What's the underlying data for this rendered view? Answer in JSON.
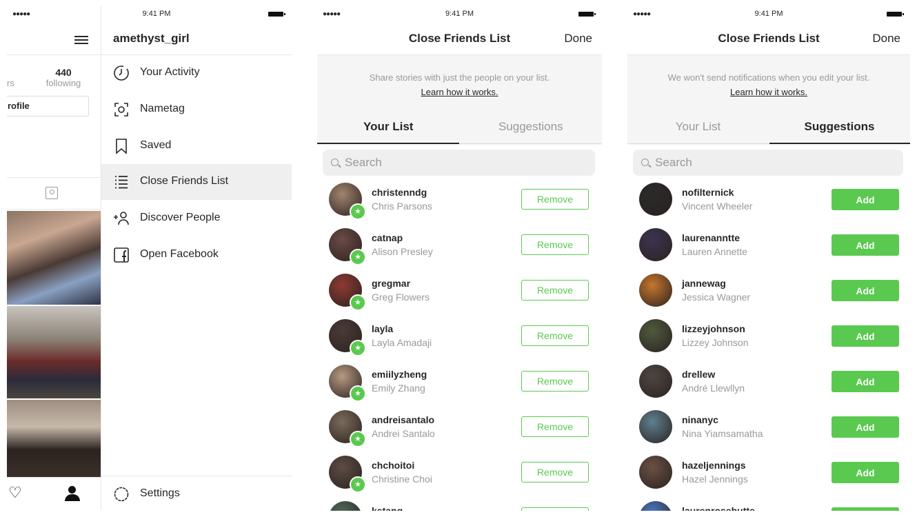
{
  "status_bar": {
    "time": "9:41 PM",
    "signal": "●●●●●"
  },
  "profile_menu": {
    "stats": {
      "following_count": "440",
      "following_label": "following",
      "followers_label_fragment": "rs"
    },
    "edit_profile_label": "rofile",
    "username": "amethyst_girl",
    "items": [
      {
        "label": "Your Activity",
        "icon": "activity-icon"
      },
      {
        "label": "Nametag",
        "icon": "nametag-icon"
      },
      {
        "label": "Saved",
        "icon": "bookmark-icon"
      },
      {
        "label": "Close Friends List",
        "icon": "list-icon",
        "active": true
      },
      {
        "label": "Discover People",
        "icon": "add-person-icon"
      },
      {
        "label": "Open Facebook",
        "icon": "facebook-icon"
      }
    ],
    "settings_label": "Settings"
  },
  "your_list_screen": {
    "title": "Close Friends List",
    "done_label": "Done",
    "info_text": "Share stories with just the people on your list.",
    "info_link": "Learn how it works.",
    "tabs": [
      "Your List",
      "Suggestions"
    ],
    "active_tab": "Your List",
    "search_placeholder": "Search",
    "button_label": "Remove",
    "rows": [
      {
        "username": "christenndg",
        "name": "Chris Parsons",
        "color": "#a2846e"
      },
      {
        "username": "catnap",
        "name": "Alison Presley",
        "color": "#6b4a45"
      },
      {
        "username": "gregmar",
        "name": "Greg Flowers",
        "color": "#8e3a32"
      },
      {
        "username": "layla",
        "name": "Layla Amadaji",
        "color": "#4a3a36"
      },
      {
        "username": "emiilyzheng",
        "name": "Emily Zhang",
        "color": "#b79a82"
      },
      {
        "username": "andreisantalo",
        "name": "Andrei Santalo",
        "color": "#7a6a5a"
      },
      {
        "username": "chchoitoi",
        "name": "Christine Choi",
        "color": "#5d4c44"
      },
      {
        "username": "kstang",
        "name": "",
        "color": "#4f6b5a"
      }
    ]
  },
  "suggestions_screen": {
    "title": "Close Friends List",
    "done_label": "Done",
    "info_text": "We won't send notifications when you edit your list.",
    "info_link": "Learn how it works.",
    "tabs": [
      "Your List",
      "Suggestions"
    ],
    "active_tab": "Suggestions",
    "search_placeholder": "Search",
    "button_label": "Add",
    "rows": [
      {
        "username": "nofilternick",
        "name": "Vincent Wheeler",
        "color": "#2a2a2a"
      },
      {
        "username": "laurenanntte",
        "name": "Lauren Annette",
        "color": "#3c3450"
      },
      {
        "username": "jannewag",
        "name": "Jessica Wagner",
        "color": "#c6762e"
      },
      {
        "username": "lizzeyjohnson",
        "name": "Lizzey Johnson",
        "color": "#4f5a3d"
      },
      {
        "username": "drellew",
        "name": "André Llewllyn",
        "color": "#4d4640"
      },
      {
        "username": "ninanyc",
        "name": "Nina Yiamsamatha",
        "color": "#5f7f8f"
      },
      {
        "username": "hazeljennings",
        "name": "Hazel Jennings",
        "color": "#6a5044"
      },
      {
        "username": "laurenrosebutte",
        "name": "",
        "color": "#4a78c8"
      }
    ]
  },
  "colors": {
    "accent_green": "#5ac94f",
    "secondary_text": "#999999",
    "primary_text": "#262626"
  }
}
